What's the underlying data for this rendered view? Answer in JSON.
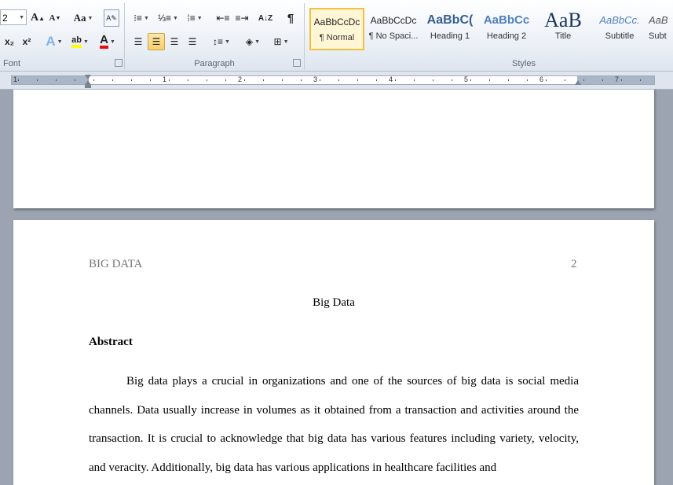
{
  "ribbon": {
    "font_group_label": "Font",
    "paragraph_group_label": "Paragraph",
    "styles_group_label": "Styles",
    "font_size_value": "2",
    "grow_font_glyph": "A",
    "shrink_font_glyph": "A",
    "change_case_label": "Aa",
    "subscript_label": "x₂",
    "superscript_label": "x²",
    "text_effects_glyph": "A",
    "highlight_glyph": "ab",
    "font_color_glyph": "A",
    "sort_glyph": "A↓Z",
    "pilcrow_glyph": "¶",
    "styles": [
      {
        "sample": "AaBbCcDc",
        "name": "¶ Normal"
      },
      {
        "sample": "AaBbCcDc",
        "name": "¶ No Spaci..."
      },
      {
        "sample": "AaBbC(",
        "name": "Heading 1"
      },
      {
        "sample": "AaBbCc",
        "name": "Heading 2"
      },
      {
        "sample": "AaB",
        "name": "Title"
      },
      {
        "sample": "AaBbCc.",
        "name": "Subtitle"
      },
      {
        "sample": "AaB",
        "name": "Subt"
      }
    ]
  },
  "ruler": {
    "numbers": [
      "1",
      "1",
      "2",
      "3",
      "4",
      "5",
      "6",
      "7"
    ]
  },
  "document": {
    "header_left": "BIG DATA",
    "header_right": "2",
    "title": "Big Data",
    "heading": "Abstract",
    "paragraph": "Big data plays a crucial in organizations and one of the sources of big data is social media channels. Data usually increase in volumes as it obtained from a transaction and activities around the transaction. It is crucial to acknowledge that big data has various features including variety, velocity, and veracity. Additionally, big data has various applications in healthcare facilities and"
  },
  "colors": {
    "workspace": "#9ba4b0",
    "active_style_border": "#f0c040",
    "header_text": "#777777"
  }
}
